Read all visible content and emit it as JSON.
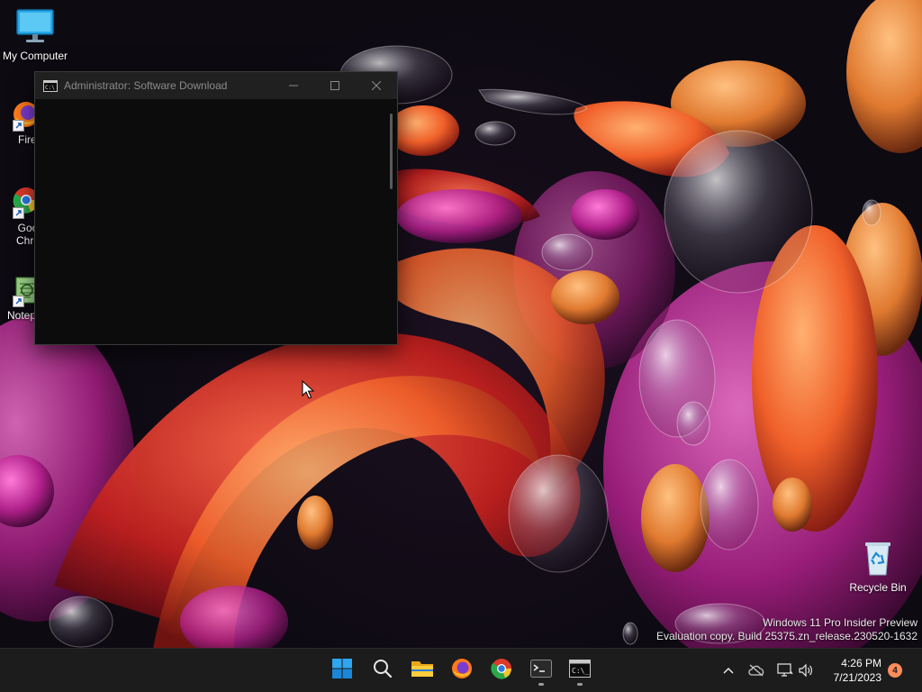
{
  "desktop": {
    "icons": [
      {
        "label": "My Computer",
        "icon": "monitor-icon"
      },
      {
        "label": "Fire",
        "icon": "firefox-icon"
      },
      {
        "label": "Goo\nChro",
        "icon": "chrome-icon"
      },
      {
        "label": "Notep",
        "icon": "notepad-icon"
      },
      {
        "label": "Recycle Bin",
        "icon": "recycle-bin-icon"
      }
    ]
  },
  "console_window": {
    "title": "Administrator:  Software Download",
    "icon": "console-icon"
  },
  "watermark": {
    "line1": "Windows 11 Pro Insider Preview",
    "line2": "Evaluation copy. Build 25375.zn_release.230520-1632"
  },
  "taskbar": {
    "apps": [
      {
        "name": "start",
        "icon": "windows-logo-icon"
      },
      {
        "name": "search",
        "icon": "search-icon"
      },
      {
        "name": "file-explorer",
        "icon": "folder-icon"
      },
      {
        "name": "firefox",
        "icon": "firefox-icon"
      },
      {
        "name": "chrome",
        "icon": "chrome-icon"
      },
      {
        "name": "terminal",
        "icon": "terminal-icon",
        "running": true
      },
      {
        "name": "console",
        "icon": "console-icon",
        "running": true
      }
    ],
    "clock": {
      "time": "4:26 PM",
      "date": "7/21/2023"
    },
    "notification_count": "4"
  },
  "colors": {
    "accent": "#0078d4",
    "badge": "#ff8c5a",
    "taskbar_bg": "#1c1c1c"
  }
}
